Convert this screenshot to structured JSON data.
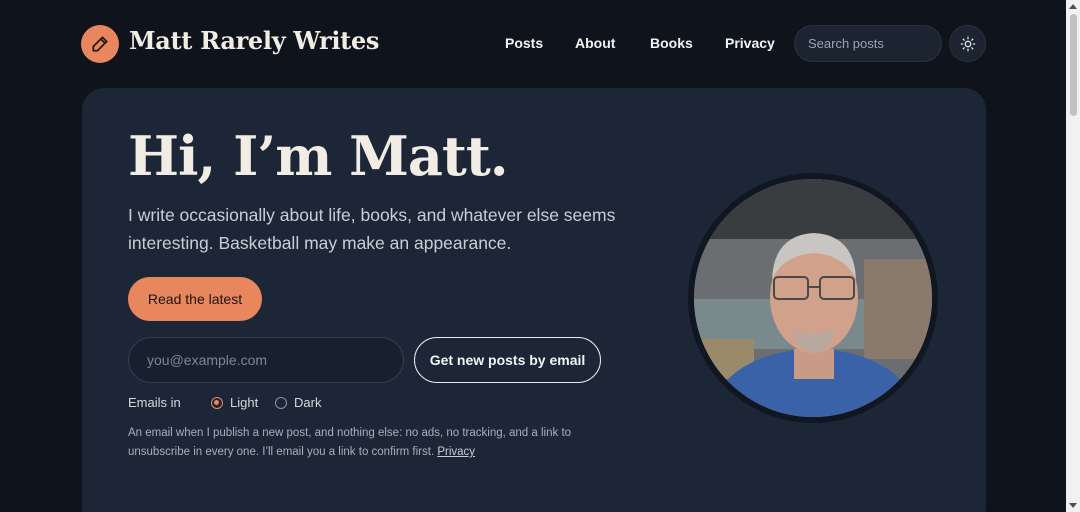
{
  "header": {
    "site_title": "Matt Rarely Writes",
    "logo_icon": "pencil-icon",
    "nav": [
      {
        "label": "Posts"
      },
      {
        "label": "About"
      },
      {
        "label": "Books"
      },
      {
        "label": "Privacy"
      }
    ],
    "search_placeholder": "Search posts",
    "theme_icon": "sun-icon"
  },
  "hero": {
    "title": "Hi, I’m Matt.",
    "subtitle": "I write occasionally about life, books, and whatever else seems interesting. Basketball may make an appearance.",
    "cta_label": "Read the latest",
    "email_placeholder": "you@example.com",
    "subscribe_label": "Get new posts by email",
    "emails_in_label": "Emails in",
    "theme_options": [
      {
        "label": "Light",
        "selected": true
      },
      {
        "label": "Dark",
        "selected": false
      }
    ],
    "fine_print": "An email when I publish a new post, and nothing else: no ads, no tracking, and a link to unsubscribe in every one. I’ll email you a link to confirm first.",
    "privacy_link": "Privacy"
  },
  "colors": {
    "background": "#0f141c",
    "card": "#1d2636",
    "accent": "#e8875e",
    "title": "#f1ede4"
  }
}
